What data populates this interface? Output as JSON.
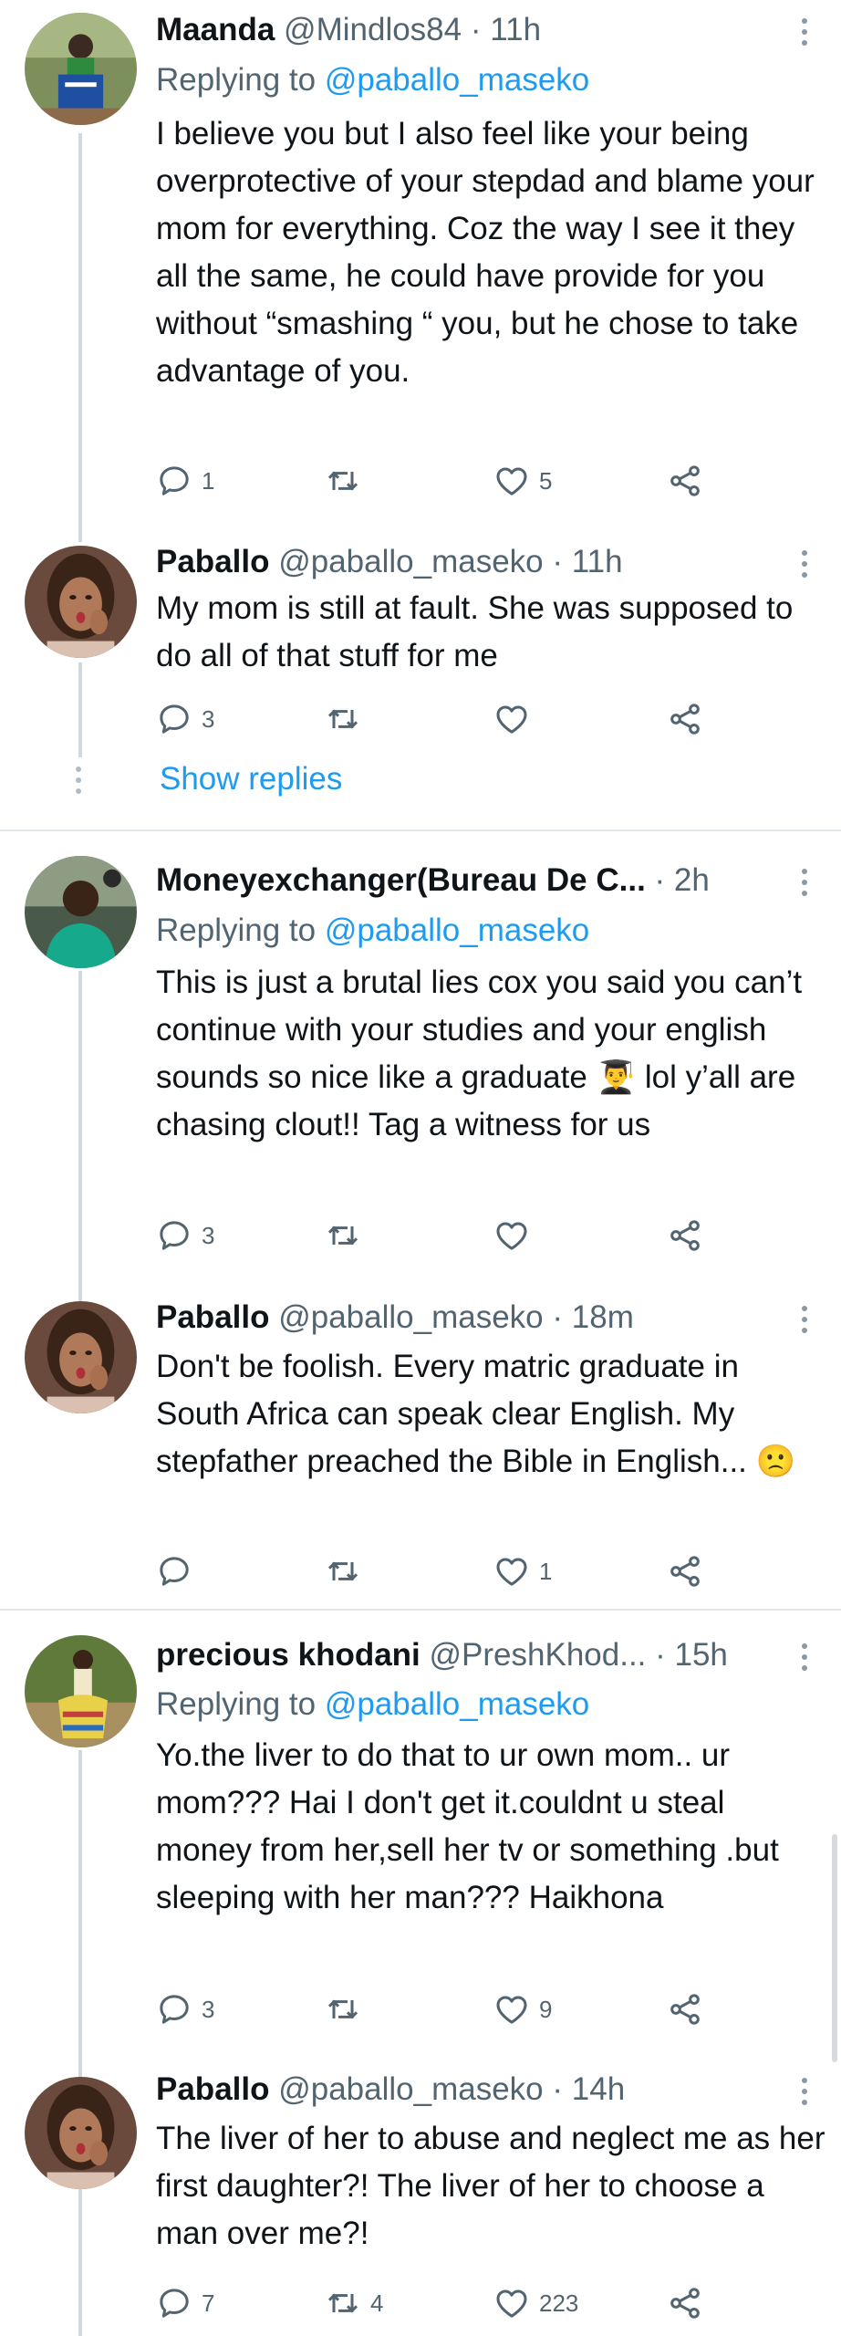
{
  "tweets": [
    {
      "name": "Maanda",
      "handle": "@Mindlos84",
      "time": "11h",
      "replying_prefix": "Replying to ",
      "replying_to": "@paballo_maseko",
      "text": "I believe you but I also feel like your being overprotective of your stepdad and blame your mom for everything. Coz the way I see it they all the same, he could have provide for you without “smashing “ you, but he chose to take advantage of you.",
      "replies": "1",
      "retweets": "",
      "likes": "5"
    },
    {
      "name": "Paballo",
      "handle": "@paballo_maseko",
      "time": "11h",
      "text": "My mom is still at fault. She was supposed to do all of that stuff for me",
      "replies": "3",
      "retweets": "",
      "likes": ""
    },
    {
      "name": "Moneyexchanger(Bureau De C...",
      "handle": "",
      "time": "2h",
      "replying_prefix": "Replying to ",
      "replying_to": "@paballo_maseko",
      "text": "This is just a brutal lies cox you said you can’t continue with your studies and your english sounds so nice like a graduate 👨‍🎓 lol y’all are chasing clout!! Tag a witness for us",
      "replies": "3",
      "retweets": "",
      "likes": ""
    },
    {
      "name": "Paballo",
      "handle": "@paballo_maseko",
      "time": "18m",
      "text": "Don't be foolish. Every matric graduate in South Africa can speak clear English. My stepfather preached the Bible in English... 🙁",
      "replies": "",
      "retweets": "",
      "likes": "1"
    },
    {
      "name": "precious khodani",
      "handle": "@PreshKhod...",
      "time": "15h",
      "replying_prefix": "Replying to ",
      "replying_to": "@paballo_maseko",
      "text": "Yo.the liver to do that to ur own mom.. ur mom??? Hai I don't get it.couldnt u steal money from her,sell her tv or something .but sleeping with her man??? Haikhona",
      "replies": "3",
      "retweets": "",
      "likes": "9"
    },
    {
      "name": "Paballo",
      "handle": "@paballo_maseko",
      "time": "14h",
      "text": "The liver of her to abuse and neglect me as her first daughter?! The liver of her to choose a man over me?!",
      "replies": "7",
      "retweets": "4",
      "likes": "223"
    }
  ],
  "show_replies": "Show replies",
  "separator": " · ",
  "icons": [
    "reply-icon",
    "retweet-icon",
    "like-icon",
    "share-icon",
    "more-icon"
  ],
  "colors": {
    "link": "#1d9bf0",
    "secondary": "#536471",
    "text": "#0f1419"
  }
}
